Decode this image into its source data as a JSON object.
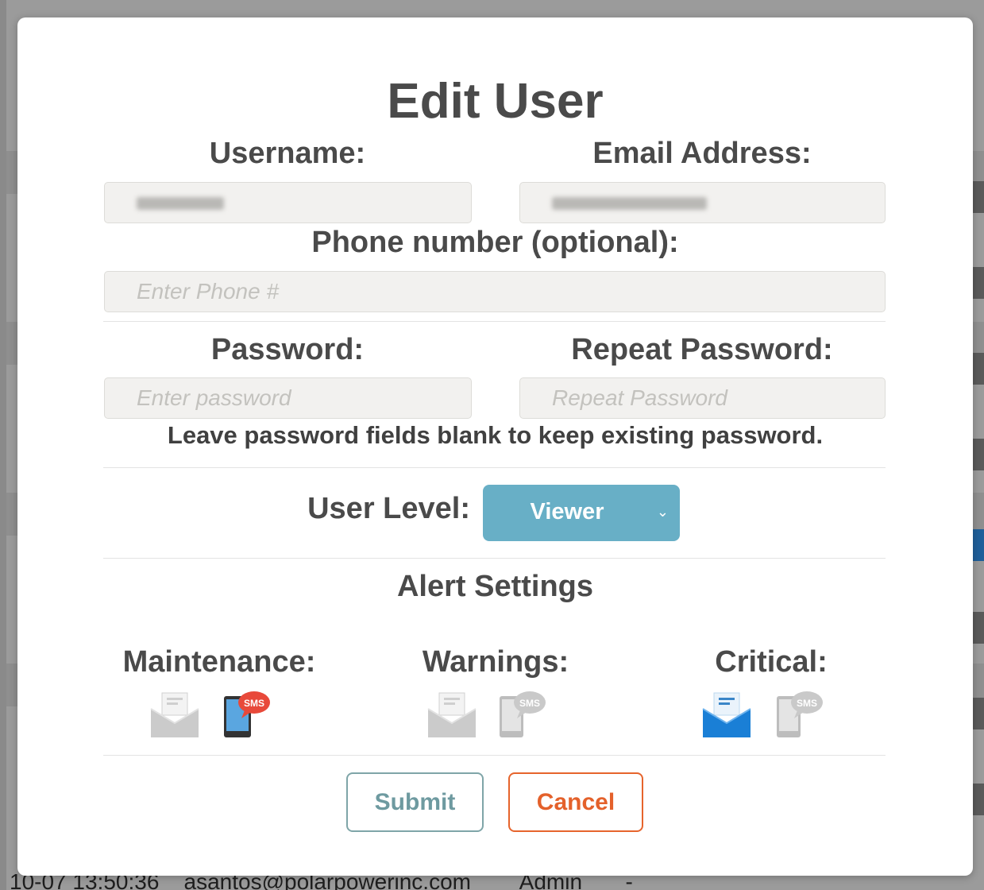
{
  "background": {
    "visible_row_text": "10-07 13:50:36    asantos@polarpowerinc.com        Admin       -"
  },
  "modal": {
    "title": "Edit User",
    "username": {
      "label": "Username:",
      "value": ""
    },
    "email": {
      "label": "Email Address:",
      "value": ""
    },
    "phone": {
      "label": "Phone number (optional):",
      "placeholder": "Enter Phone #"
    },
    "password": {
      "label": "Password:",
      "placeholder": "Enter password"
    },
    "repeat_password": {
      "label": "Repeat Password:",
      "placeholder": "Repeat Password"
    },
    "password_hint": "Leave password fields blank to keep existing password.",
    "user_level": {
      "label": "User Level:",
      "selected": "Viewer"
    },
    "alert_settings": {
      "heading": "Alert Settings",
      "groups": [
        {
          "label": "Maintenance:",
          "email_enabled": false,
          "sms_enabled": true
        },
        {
          "label": "Warnings:",
          "email_enabled": false,
          "sms_enabled": false
        },
        {
          "label": "Critical:",
          "email_enabled": true,
          "sms_enabled": false
        }
      ],
      "sms_badge_text": "SMS"
    },
    "submit_label": "Submit",
    "cancel_label": "Cancel"
  },
  "colors": {
    "select_bg": "#68afc6",
    "submit_border": "#7fa5a8",
    "cancel_border": "#e6642c",
    "email_active": "#1a7fd6",
    "sms_active_badge": "#e8493a",
    "inactive_icon": "#c9c9c9"
  }
}
